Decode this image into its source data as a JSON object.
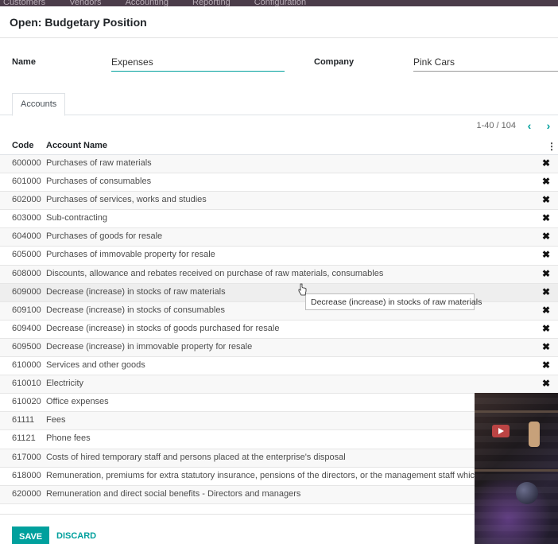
{
  "background_nav": {
    "items": [
      "Customers",
      "Vendors",
      "Accounting",
      "Reporting",
      "Configuration"
    ]
  },
  "modal": {
    "title": "Open: Budgetary Position"
  },
  "form": {
    "name_label": "Name",
    "name_value": "Expenses",
    "company_label": "Company",
    "company_value": "Pink Cars"
  },
  "tabs": [
    {
      "label": "Accounts",
      "active": true
    }
  ],
  "pager": {
    "value": "1-40 / 104",
    "prev_icon": "chevron-left-icon",
    "next_icon": "chevron-right-icon"
  },
  "table": {
    "columns": [
      "Code",
      "Account Name"
    ],
    "rows": [
      {
        "code": "600000",
        "name": "Purchases of raw materials"
      },
      {
        "code": "601000",
        "name": "Purchases of consumables"
      },
      {
        "code": "602000",
        "name": "Purchases of services, works and studies"
      },
      {
        "code": "603000",
        "name": "Sub-contracting"
      },
      {
        "code": "604000",
        "name": "Purchases of goods for resale"
      },
      {
        "code": "605000",
        "name": "Purchases of immovable property for resale"
      },
      {
        "code": "608000",
        "name": "Discounts, allowance and rebates received on purchase of raw materials, consumables"
      },
      {
        "code": "609000",
        "name": "Decrease (increase) in stocks of raw materials"
      },
      {
        "code": "609100",
        "name": "Decrease (increase) in stocks of consumables"
      },
      {
        "code": "609400",
        "name": "Decrease (increase) in stocks of goods purchased for resale"
      },
      {
        "code": "609500",
        "name": "Decrease (increase) in immovable property for resale"
      },
      {
        "code": "610000",
        "name": "Services and other goods"
      },
      {
        "code": "610010",
        "name": "Electricity"
      },
      {
        "code": "610020",
        "name": "Office expenses"
      },
      {
        "code": "61111",
        "name": "Fees"
      },
      {
        "code": "61121",
        "name": "Phone fees"
      },
      {
        "code": "617000",
        "name": "Costs of hired temporary staff and persons placed at the enterprise's disposal"
      },
      {
        "code": "618000",
        "name": "Remuneration, premiums for extra statutory insurance, pensions of the directors, or the management staff which"
      },
      {
        "code": "620000",
        "name": "Remuneration and direct social benefits - Directors and managers"
      }
    ]
  },
  "tooltip": {
    "text": "Decrease (increase) in stocks of raw materials"
  },
  "footer": {
    "save_label": "SAVE",
    "discard_label": "DISCARD"
  },
  "colors": {
    "accent": "#00a09d",
    "nav_bg": "#4c3d4a"
  }
}
